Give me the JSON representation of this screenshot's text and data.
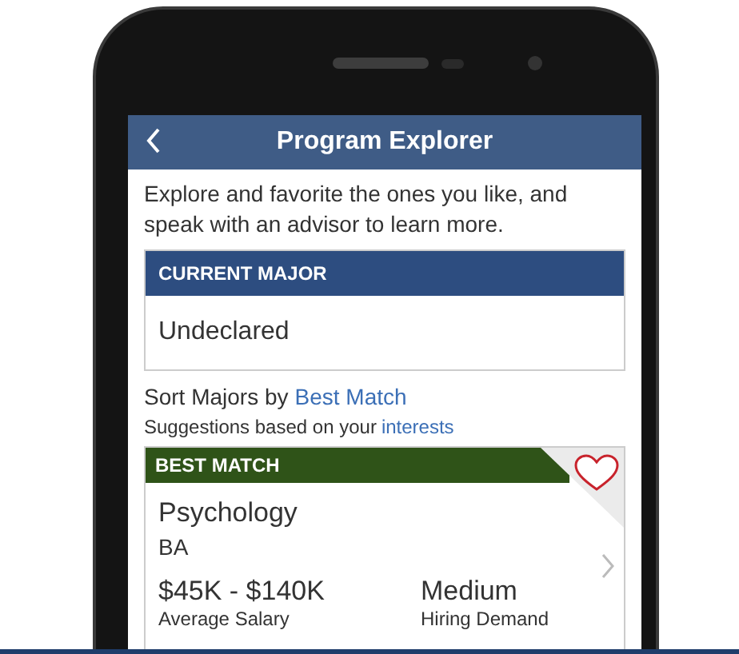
{
  "header": {
    "title": "Program Explorer"
  },
  "intro": "Explore and favorite the ones you like, and speak with an advisor to learn more.",
  "current_major": {
    "heading": "CURRENT MAJOR",
    "value": "Undeclared"
  },
  "sort": {
    "label": "Sort Majors by",
    "option": "Best Match"
  },
  "suggestions": {
    "text": "Suggestions based on your",
    "link": "interests"
  },
  "cards": [
    {
      "badge": "BEST MATCH",
      "name": "Psychology",
      "degree": "BA",
      "favorited": false,
      "salary": "$45K - $140K",
      "salary_label": "Average Salary",
      "demand": "Medium",
      "demand_label": "Hiring Demand"
    }
  ]
}
